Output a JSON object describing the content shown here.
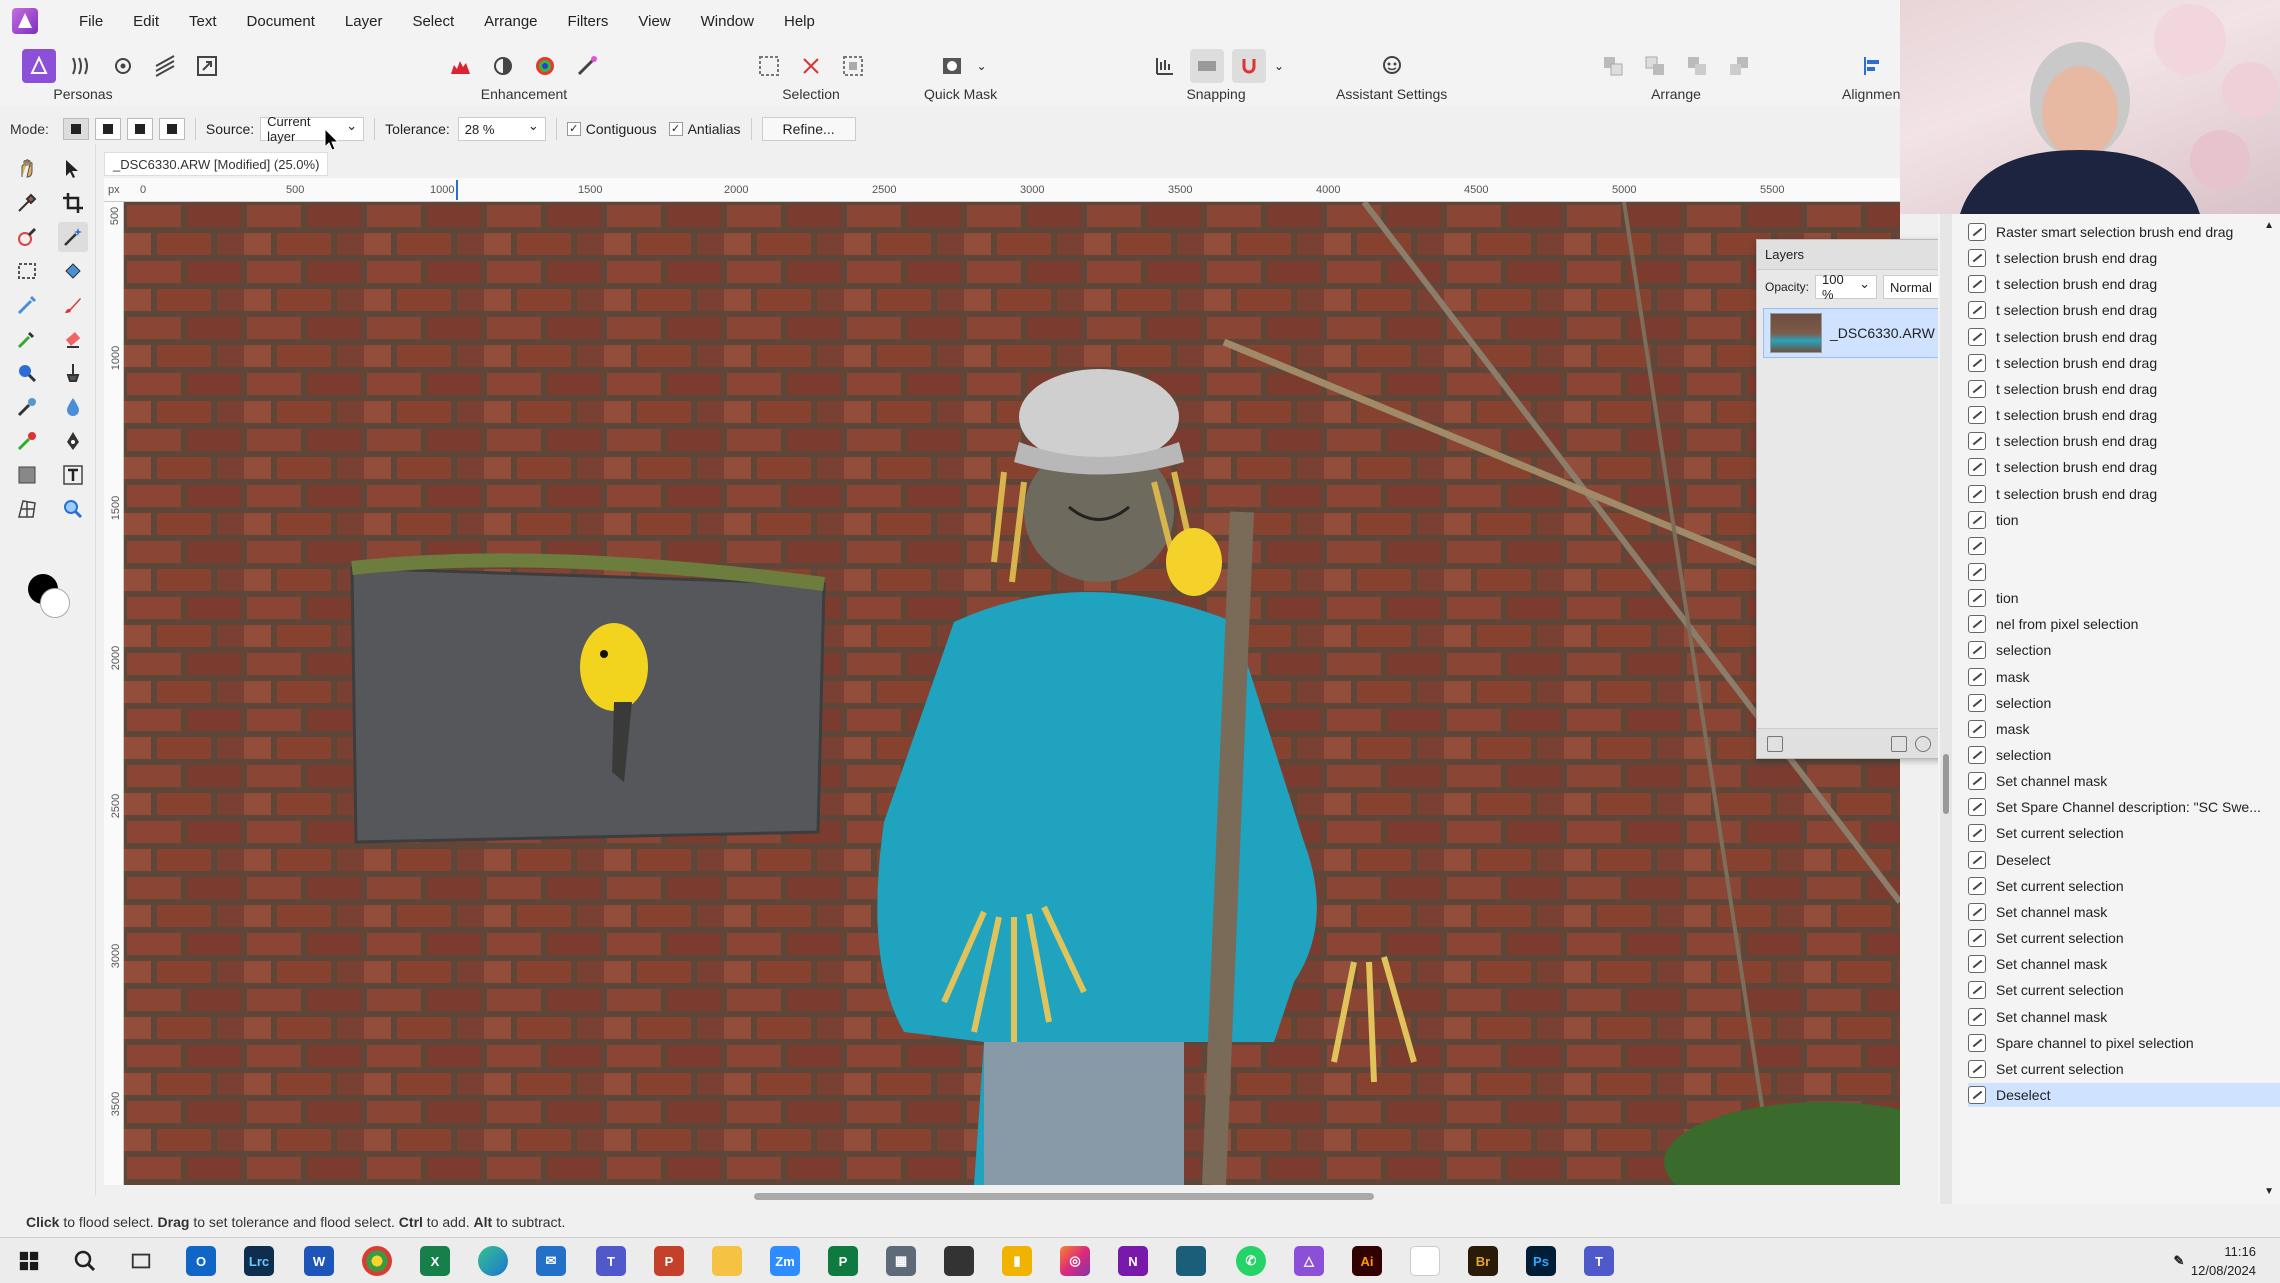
{
  "menu": [
    "File",
    "Edit",
    "Text",
    "Document",
    "Layer",
    "Select",
    "Arrange",
    "Filters",
    "View",
    "Window",
    "Help"
  ],
  "toolbar": {
    "personas_label": "Personas",
    "enhancement_label": "Enhancement",
    "selection_label": "Selection",
    "quick_mask_label": "Quick Mask",
    "snapping_label": "Snapping",
    "assistant_label": "Assistant Settings",
    "arrange_label": "Arrange",
    "alignment_label": "Alignment"
  },
  "context": {
    "mode_label": "Mode:",
    "source_label": "Source:",
    "source_value": "Current layer",
    "tolerance_label": "Tolerance:",
    "tolerance_value": "28 %",
    "contiguous_label": "Contiguous",
    "antialias_label": "Antialias",
    "refine_label": "Refine..."
  },
  "document": {
    "tab_title": "_DSC6330.ARW [Modified] (25.0%)",
    "ruler_unit": "px",
    "h_ticks": [
      "0",
      "500",
      "1000",
      "1500",
      "2000",
      "2500",
      "3000",
      "3500",
      "4000",
      "4500",
      "5000",
      "5500"
    ],
    "v_ticks": [
      "500",
      "1000",
      "1500",
      "2000",
      "2500",
      "3000",
      "3500"
    ]
  },
  "layers": {
    "title": "Layers",
    "opacity_label": "Opacity:",
    "opacity_value": "100 %",
    "blend_mode": "Normal",
    "layer_name": "_DSC6330.ARW"
  },
  "history": {
    "items": [
      "Raster smart selection brush end drag",
      "t selection brush end drag",
      "t selection brush end drag",
      "t selection brush end drag",
      "t selection brush end drag",
      "t selection brush end drag",
      "t selection brush end drag",
      "t selection brush end drag",
      "t selection brush end drag",
      "t selection brush end drag",
      "t selection brush end drag",
      "tion",
      "",
      "",
      "tion",
      "nel from pixel selection",
      "selection",
      "mask",
      "selection",
      "mask",
      "selection",
      "Set channel mask",
      "Set Spare Channel description: \"SC Swe...",
      "Set current selection",
      "Deselect",
      "Set current selection",
      "Set channel mask",
      "Set current selection",
      "Set channel mask",
      "Set current selection",
      "Set channel mask",
      "Spare channel to pixel selection",
      "Set current selection",
      "Deselect"
    ]
  },
  "status": {
    "text_parts": [
      "Click",
      " to flood select. ",
      "Drag",
      " to set tolerance and flood select. ",
      "Ctrl",
      " to add. ",
      "Alt",
      " to subtract."
    ]
  },
  "taskbar": {
    "time": "11:16",
    "date": "12/08/2024",
    "apps": [
      "Lrc",
      "Zm",
      "N",
      "Ai",
      "Br",
      "Ps"
    ]
  },
  "colors": {
    "accent": "#8b4fd8",
    "selection": "#cfe2ff",
    "sweater": "#1fa3bf",
    "brick": "#7a3f2f"
  }
}
